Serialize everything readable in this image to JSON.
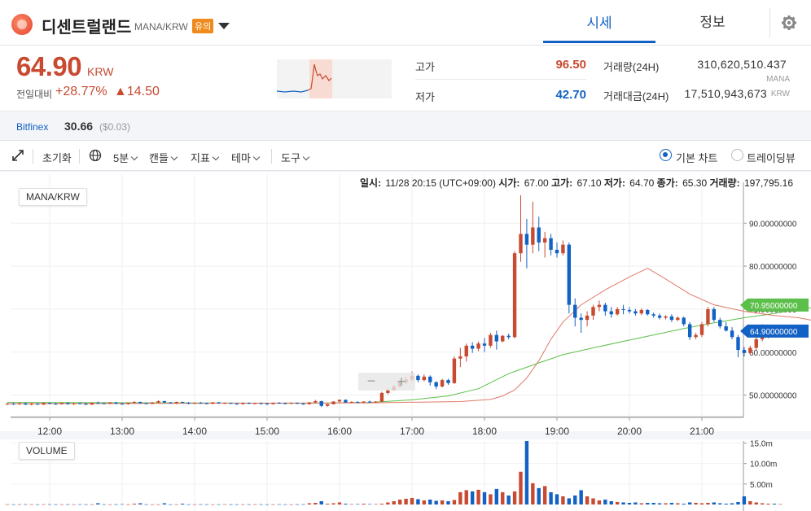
{
  "header": {
    "coin_name": "디센트럴랜드",
    "pair": "MANA/KRW",
    "warning_badge": "유의",
    "tab_quote": "시세",
    "tab_info": "정보"
  },
  "price": {
    "current": "64.90",
    "unit": "KRW",
    "change_label": "전일대비",
    "change_pct": "+28.77%",
    "change_abs": "▲14.50"
  },
  "stats": {
    "high_label": "고가",
    "high": "96.50",
    "low_label": "저가",
    "low": "42.70",
    "vol_label": "거래량(24H)",
    "vol": "310,620,510.437",
    "vol_unit": "MANA",
    "value_label": "거래대금(24H)",
    "value": "17,510,943,673",
    "value_unit": "KRW"
  },
  "external": {
    "exchange": "Bitfinex",
    "price": "30.66",
    "usd": "($0.03)"
  },
  "toolbar": {
    "reset": "초기화",
    "interval": "5분",
    "candle": "캔들",
    "indicator": "지표",
    "theme": "테마",
    "tools": "도구",
    "basic_chart": "기본 차트",
    "tradingview": "트레이딩뷰"
  },
  "ohlc": {
    "time_label": "일시:",
    "time": "11/28 20:15 (UTC+09:00)",
    "open_label": "시가:",
    "open": "67.00",
    "high_label": "고가:",
    "high": "67.10",
    "low_label": "저가:",
    "low": "64.70",
    "close_label": "종가:",
    "close": "65.30",
    "vol_label": "거래량:",
    "vol": "197,795.16"
  },
  "colors": {
    "up": "#c84a31",
    "down": "#1261c4",
    "ma_short": "#e07a6a",
    "ma_long": "#5cbf4a",
    "accent": "#1261c4"
  },
  "icons": {
    "expand": "expand-icon",
    "globe": "globe-icon",
    "settings": "gear-icon",
    "zoom_in": "plus-icon",
    "zoom_out": "minus-icon"
  },
  "chart_data": {
    "type": "candlestick",
    "pair_label": "MANA/KRW",
    "volume_label": "VOLUME",
    "x_ticks": [
      "12:00",
      "13:00",
      "14:00",
      "15:00",
      "16:00",
      "17:00",
      "18:00",
      "19:00",
      "20:00",
      "21:00"
    ],
    "y_ticks": [
      "90.00000000",
      "80.00000000",
      "70.00000000",
      "60.00000000",
      "50.00000000"
    ],
    "y_range": [
      45,
      98
    ],
    "vol_ticks": [
      "15.0m",
      "10.00m",
      "5.00m"
    ],
    "vol_range_m": [
      0,
      15.5
    ],
    "ma_long_label": "70.95000000",
    "last_price_label": "64.90000000",
    "candles_start": "11:25",
    "interval_min": 5,
    "candles": [
      [
        48.0,
        48.2,
        47.7,
        48.0
      ],
      [
        48.0,
        48.2,
        47.8,
        47.9
      ],
      [
        47.9,
        48.3,
        47.7,
        48.1
      ],
      [
        48.1,
        48.2,
        47.7,
        47.8
      ],
      [
        47.8,
        48.2,
        47.6,
        48.0
      ],
      [
        48.0,
        48.1,
        47.7,
        47.8
      ],
      [
        47.8,
        48.3,
        47.7,
        48.2
      ],
      [
        48.2,
        48.3,
        47.9,
        48.0
      ],
      [
        48.0,
        48.2,
        47.8,
        47.9
      ],
      [
        47.9,
        48.3,
        47.8,
        48.2
      ],
      [
        48.2,
        48.3,
        47.8,
        47.9
      ],
      [
        47.9,
        48.2,
        47.7,
        48.1
      ],
      [
        48.1,
        48.3,
        47.9,
        48.0
      ],
      [
        48.0,
        48.2,
        47.7,
        47.8
      ],
      [
        47.8,
        48.3,
        47.7,
        48.2
      ],
      [
        48.2,
        48.5,
        48.0,
        48.1
      ],
      [
        48.1,
        48.3,
        47.9,
        48.0
      ],
      [
        48.0,
        48.4,
        47.9,
        48.3
      ],
      [
        48.3,
        48.4,
        47.9,
        48.0
      ],
      [
        48.0,
        48.2,
        47.8,
        47.9
      ],
      [
        47.9,
        48.3,
        47.8,
        48.2
      ],
      [
        48.2,
        48.6,
        48.0,
        48.4
      ],
      [
        48.4,
        48.5,
        48.0,
        48.1
      ],
      [
        48.1,
        48.3,
        47.9,
        48.0
      ],
      [
        48.0,
        48.4,
        47.9,
        48.3
      ],
      [
        48.3,
        48.8,
        48.1,
        48.6
      ],
      [
        48.6,
        48.7,
        48.2,
        48.3
      ],
      [
        48.3,
        48.4,
        48.0,
        48.1
      ],
      [
        48.1,
        48.5,
        47.9,
        48.4
      ],
      [
        48.4,
        48.5,
        48.1,
        48.2
      ],
      [
        48.2,
        48.4,
        47.9,
        48.0
      ],
      [
        48.0,
        48.3,
        47.9,
        48.2
      ],
      [
        48.2,
        48.4,
        48.0,
        48.1
      ],
      [
        48.1,
        48.3,
        47.9,
        48.0
      ],
      [
        48.0,
        48.4,
        47.9,
        48.3
      ],
      [
        48.3,
        48.4,
        48.0,
        48.1
      ],
      [
        48.1,
        48.3,
        47.9,
        48.2
      ],
      [
        48.2,
        48.3,
        47.9,
        48.0
      ],
      [
        48.0,
        48.2,
        47.8,
        47.9
      ],
      [
        47.9,
        48.3,
        47.8,
        48.2
      ],
      [
        48.2,
        48.3,
        47.9,
        48.0
      ],
      [
        48.0,
        48.2,
        47.9,
        48.1
      ],
      [
        48.1,
        48.3,
        47.9,
        48.0
      ],
      [
        48.0,
        48.2,
        47.8,
        47.9
      ],
      [
        47.9,
        48.3,
        47.8,
        48.2
      ],
      [
        48.2,
        48.4,
        48.0,
        48.1
      ],
      [
        48.1,
        48.3,
        47.9,
        48.0
      ],
      [
        48.0,
        48.3,
        47.9,
        48.2
      ],
      [
        48.2,
        48.3,
        47.9,
        48.0
      ],
      [
        48.0,
        48.2,
        47.8,
        47.9
      ],
      [
        47.9,
        48.4,
        47.8,
        48.3
      ],
      [
        48.3,
        48.9,
        48.1,
        48.6
      ],
      [
        48.6,
        48.7,
        47.2,
        47.5
      ],
      [
        47.5,
        48.0,
        47.3,
        47.9
      ],
      [
        47.9,
        48.6,
        47.8,
        48.5
      ],
      [
        48.5,
        49.0,
        48.3,
        48.9
      ],
      [
        48.9,
        49.0,
        48.2,
        48.3
      ],
      [
        48.3,
        48.6,
        48.1,
        48.4
      ],
      [
        48.4,
        48.6,
        48.2,
        48.3
      ],
      [
        48.3,
        48.6,
        48.1,
        48.5
      ],
      [
        48.5,
        48.7,
        48.2,
        48.4
      ],
      [
        48.4,
        48.6,
        48.2,
        48.5
      ],
      [
        48.5,
        50.8,
        48.4,
        50.5
      ],
      [
        50.5,
        51.5,
        50.2,
        51.2
      ],
      [
        51.2,
        52.3,
        51.0,
        52.0
      ],
      [
        52.0,
        53.5,
        51.8,
        53.0
      ],
      [
        53.0,
        54.2,
        52.5,
        53.6
      ],
      [
        53.6,
        55.5,
        53.2,
        54.5
      ],
      [
        54.5,
        54.8,
        53.0,
        53.5
      ],
      [
        53.5,
        54.8,
        53.2,
        54.3
      ],
      [
        54.3,
        54.6,
        52.2,
        53.0
      ],
      [
        53.0,
        53.2,
        51.4,
        52.0
      ],
      [
        52.0,
        53.8,
        51.8,
        53.5
      ],
      [
        53.5,
        53.8,
        52.4,
        52.8
      ],
      [
        52.8,
        59.0,
        52.6,
        58.5
      ],
      [
        58.5,
        61.0,
        56.5,
        59.0
      ],
      [
        59.0,
        62.0,
        57.8,
        61.5
      ],
      [
        61.5,
        62.3,
        59.8,
        60.8
      ],
      [
        60.8,
        62.5,
        60.2,
        62.0
      ],
      [
        62.0,
        63.3,
        60.0,
        61.5
      ],
      [
        61.5,
        64.5,
        61.0,
        64.0
      ],
      [
        64.0,
        65.0,
        60.6,
        62.5
      ],
      [
        62.5,
        64.0,
        62.3,
        63.8
      ],
      [
        63.8,
        64.3,
        63.0,
        63.5
      ],
      [
        63.5,
        83.5,
        63.2,
        83.0
      ],
      [
        83.0,
        96.5,
        81.0,
        87.5
      ],
      [
        87.5,
        91.0,
        79.5,
        85.0
      ],
      [
        85.0,
        95.0,
        83.0,
        89.0
      ],
      [
        89.0,
        91.5,
        83.5,
        85.5
      ],
      [
        85.5,
        88.0,
        82.0,
        86.5
      ],
      [
        86.5,
        87.5,
        82.5,
        83.8
      ],
      [
        83.8,
        85.5,
        82.0,
        83.0
      ],
      [
        83.0,
        86.0,
        82.5,
        85.0
      ],
      [
        85.0,
        85.5,
        69.0,
        71.0
      ],
      [
        71.0,
        72.5,
        66.0,
        68.0
      ],
      [
        68.0,
        69.0,
        64.5,
        67.5
      ],
      [
        67.5,
        69.5,
        66.0,
        68.5
      ],
      [
        68.5,
        71.0,
        67.5,
        70.5
      ],
      [
        70.5,
        72.0,
        69.5,
        71.0
      ],
      [
        71.0,
        71.5,
        68.5,
        69.5
      ],
      [
        69.5,
        70.5,
        68.0,
        68.8
      ],
      [
        68.8,
        70.5,
        68.5,
        70.0
      ],
      [
        70.0,
        71.0,
        68.8,
        69.8
      ],
      [
        69.8,
        70.5,
        69.0,
        69.5
      ],
      [
        69.5,
        70.0,
        68.5,
        69.0
      ],
      [
        69.0,
        70.2,
        68.6,
        69.8
      ],
      [
        69.8,
        70.0,
        68.5,
        68.8
      ],
      [
        68.8,
        69.2,
        68.0,
        68.5
      ],
      [
        68.5,
        69.0,
        67.6,
        68.0
      ],
      [
        68.0,
        68.6,
        67.6,
        68.3
      ],
      [
        68.3,
        68.8,
        67.0,
        67.5
      ],
      [
        67.5,
        68.3,
        67.2,
        68.0
      ],
      [
        68.0,
        68.3,
        66.0,
        66.5
      ],
      [
        66.5,
        67.0,
        62.8,
        63.5
      ],
      [
        63.5,
        64.5,
        63.0,
        64.0
      ],
      [
        64.0,
        67.0,
        63.5,
        66.5
      ],
      [
        66.5,
        70.5,
        66.0,
        70.0
      ],
      [
        70.0,
        70.5,
        67.0,
        67.5
      ],
      [
        67.5,
        68.0,
        65.5,
        66.0
      ],
      [
        66.0,
        67.0,
        64.8,
        65.0
      ],
      [
        65.0,
        65.8,
        63.0,
        63.5
      ],
      [
        63.5,
        64.0,
        58.8,
        60.5
      ],
      [
        60.5,
        61.2,
        59.0,
        59.8
      ],
      [
        59.8,
        61.5,
        59.5,
        61.0
      ],
      [
        61.0,
        63.5,
        60.5,
        63.0
      ],
      [
        63.0,
        66.5,
        62.5,
        64.0
      ],
      [
        64.0,
        65.0,
        63.2,
        64.7
      ],
      [
        64.7,
        65.0,
        64.0,
        64.5
      ],
      [
        64.5,
        65.0,
        63.6,
        64.9
      ]
    ],
    "volumes_m": [
      0.05,
      0.05,
      0.05,
      0.06,
      0.05,
      0.04,
      0.05,
      0.06,
      0.04,
      0.05,
      0.05,
      0.04,
      0.06,
      0.05,
      0.04,
      0.3,
      0.05,
      0.04,
      0.05,
      0.1,
      0.04,
      0.2,
      0.3,
      0.05,
      0.04,
      0.05,
      0.3,
      0.04,
      0.05,
      0.2,
      0.04,
      0.05,
      0.06,
      0.05,
      0.04,
      0.05,
      0.06,
      0.04,
      0.05,
      0.05,
      0.05,
      0.04,
      0.06,
      0.05,
      0.04,
      0.06,
      0.05,
      0.04,
      0.05,
      0.06,
      0.3,
      0.4,
      0.8,
      0.2,
      0.3,
      0.5,
      0.2,
      0.1,
      0.1,
      0.2,
      0.1,
      0.1,
      0.2,
      0.5,
      0.8,
      1.2,
      1.4,
      1.6,
      1.3,
      1.0,
      1.2,
      0.9,
      1.0,
      0.8,
      1.1,
      3.0,
      3.5,
      3.2,
      3.6,
      3.0,
      2.5,
      3.8,
      3.0,
      2.2,
      3.2,
      8.0,
      15.5,
      5.2,
      4.0,
      4.5,
      3.0,
      2.5,
      2.0,
      1.5,
      2.2,
      3.5,
      2.0,
      1.5,
      1.0,
      1.2,
      0.8,
      0.6,
      0.5,
      0.4,
      0.5,
      0.3,
      0.4,
      0.4,
      0.3,
      0.3,
      0.4,
      0.3,
      0.2,
      0.5,
      0.4,
      0.3,
      0.4,
      0.5,
      0.3,
      0.2,
      0.3,
      0.6,
      2.0,
      0.8,
      0.5,
      0.3,
      0.2,
      0.2,
      0.1
    ],
    "ma_short": [
      [
        0,
        48.0
      ],
      [
        60,
        48.2
      ],
      [
        75,
        48.5
      ],
      [
        80,
        49.0
      ],
      [
        82,
        49.8
      ],
      [
        84,
        51.2
      ],
      [
        86,
        54.0
      ],
      [
        88,
        58.0
      ],
      [
        90,
        63.0
      ],
      [
        92,
        67.0
      ],
      [
        95,
        71.0
      ],
      [
        99,
        74.5
      ],
      [
        103,
        77.5
      ],
      [
        106,
        79.5
      ],
      [
        109,
        77.0
      ],
      [
        113,
        73.5
      ],
      [
        117,
        71.0
      ],
      [
        122,
        69.5
      ],
      [
        127,
        68.5
      ],
      [
        131,
        68.0
      ],
      [
        136,
        66.7
      ],
      [
        142,
        64.8
      ],
      [
        147,
        64.2
      ]
    ],
    "ma_long": [
      [
        0,
        48.3
      ],
      [
        50,
        48.1
      ],
      [
        60,
        48.3
      ],
      [
        67,
        48.9
      ],
      [
        73,
        49.8
      ],
      [
        78,
        51.5
      ],
      [
        83,
        55.0
      ],
      [
        88,
        57.5
      ],
      [
        92,
        59.4
      ],
      [
        97,
        61.0
      ],
      [
        102,
        62.5
      ],
      [
        107,
        64.0
      ],
      [
        112,
        65.5
      ],
      [
        117,
        66.8
      ],
      [
        122,
        68.0
      ],
      [
        127,
        69.0
      ],
      [
        132,
        70.2
      ],
      [
        137,
        70.8
      ],
      [
        142,
        71.0
      ],
      [
        147,
        71.2
      ]
    ]
  }
}
